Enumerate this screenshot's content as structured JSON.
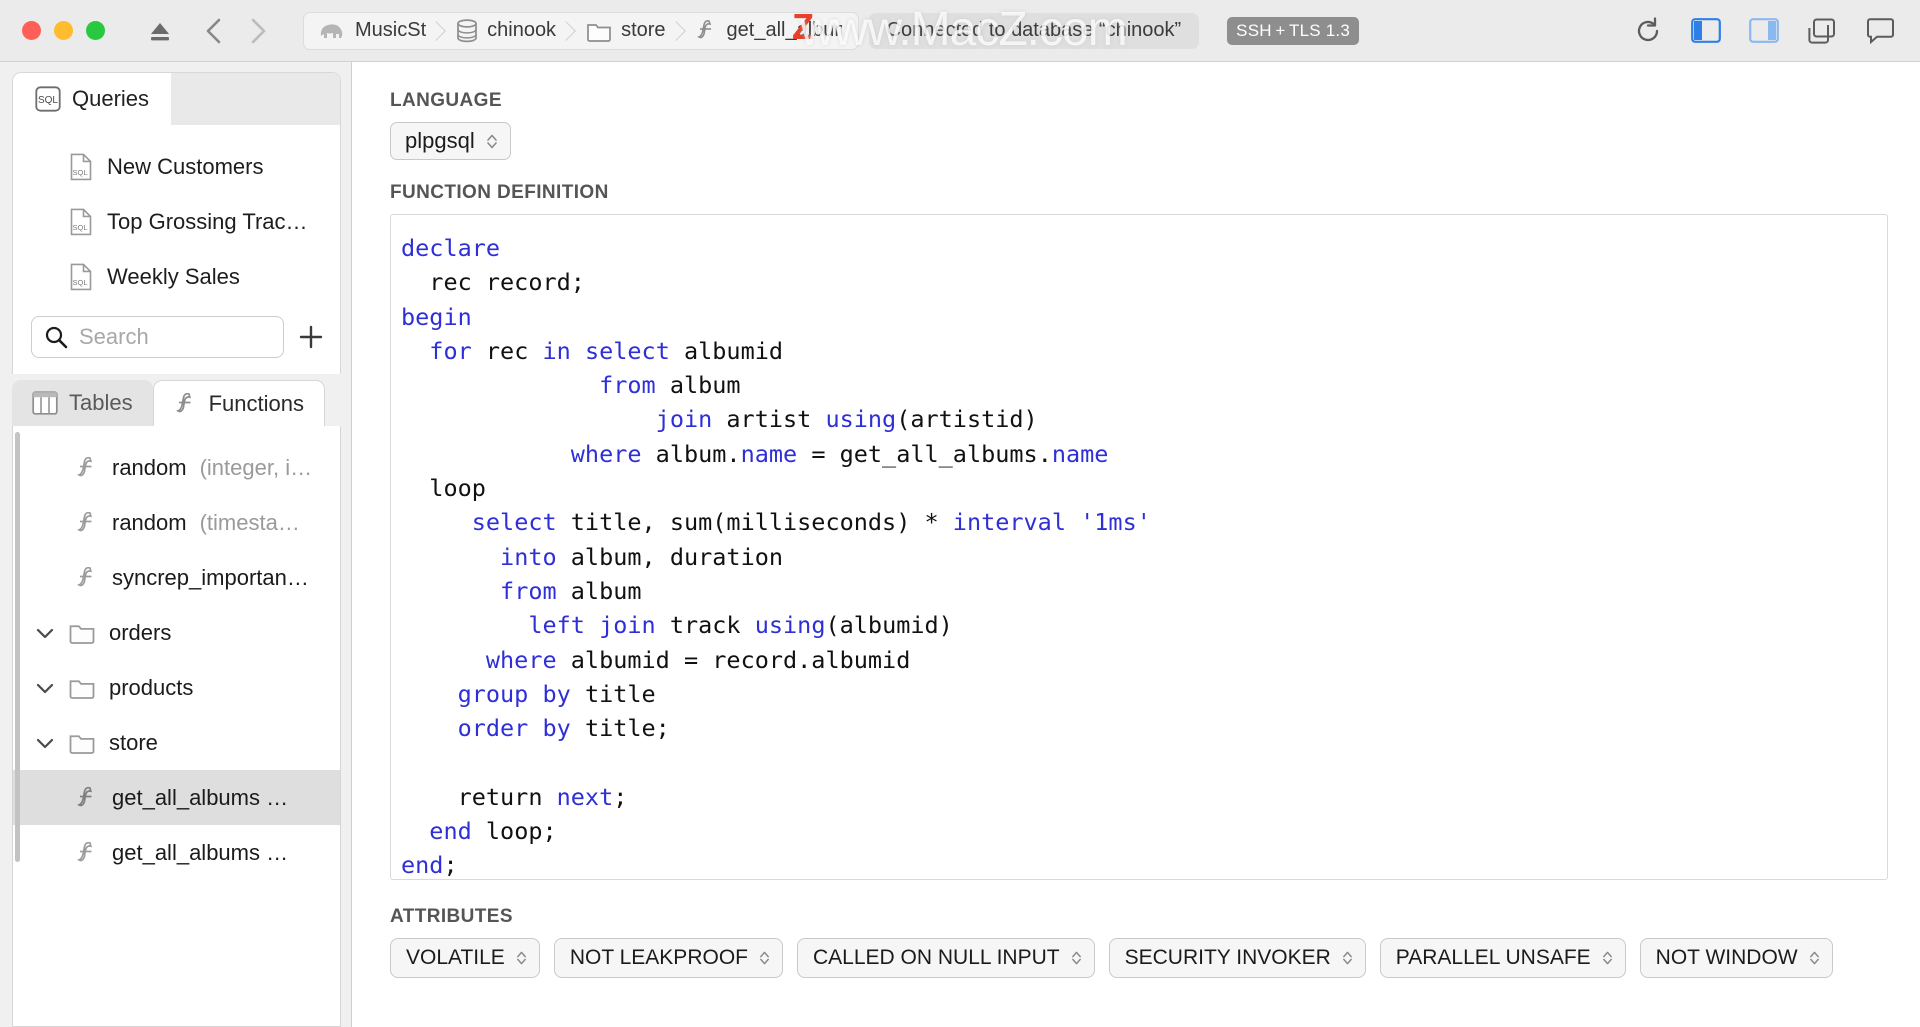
{
  "window": {
    "traffic_lights": [
      "close",
      "minimize",
      "maximize"
    ],
    "watermark": "www.MacZ.com"
  },
  "toolbar": {
    "eject_icon": "eject-icon",
    "back_label": "‹",
    "forward_label": "›",
    "breadcrumb": [
      {
        "label": "MusicSt",
        "icon": "elephant-icon"
      },
      {
        "label": "chinook",
        "icon": "database-icon"
      },
      {
        "label": "store",
        "icon": "folder-icon"
      },
      {
        "label": "get_all_albums",
        "icon": "function-icon"
      }
    ],
    "status": "Connected to database “chinook”",
    "security_badge": "SSH + TLS 1.3",
    "icons": [
      "refresh-icon",
      "left-panel-icon",
      "right-panel-icon",
      "new-window-icon",
      "comment-icon"
    ]
  },
  "sidebar": {
    "queries_tab": {
      "label": "Queries",
      "icon": "sql-icon"
    },
    "queries": [
      {
        "label": "New Customers",
        "icon": "sql-file-icon"
      },
      {
        "label": "Top Grossing Trac…",
        "icon": "sql-file-icon"
      },
      {
        "label": "Weekly Sales",
        "icon": "sql-file-icon"
      }
    ],
    "search": {
      "placeholder": "Search",
      "icon": "search-icon"
    },
    "add_button": "+",
    "lower_tabs": [
      {
        "label": "Tables",
        "icon": "table-icon",
        "active": false
      },
      {
        "label": "Functions",
        "icon": "function-icon",
        "active": true
      }
    ],
    "functions": [
      {
        "name": "random ",
        "args": "(integer, i…",
        "type": "function",
        "indent": 1,
        "selected": false
      },
      {
        "name": "random ",
        "args": "(timesta…",
        "type": "function",
        "indent": 1,
        "selected": false
      },
      {
        "name": "syncrep_importan…",
        "args": "",
        "type": "function",
        "indent": 1,
        "selected": false
      },
      {
        "name": "orders",
        "args": "",
        "type": "folder",
        "indent": 0,
        "selected": false
      },
      {
        "name": "products",
        "args": "",
        "type": "folder",
        "indent": 0,
        "selected": false
      },
      {
        "name": "store",
        "args": "",
        "type": "folder",
        "indent": 0,
        "selected": false
      },
      {
        "name": "get_all_albums …",
        "args": "",
        "type": "function",
        "indent": 1,
        "selected": true
      },
      {
        "name": "get_all_albums …",
        "args": "",
        "type": "function",
        "indent": 1,
        "selected": false
      }
    ]
  },
  "editor": {
    "language_label": "LANGUAGE",
    "language_value": "plpgsql",
    "definition_label": "FUNCTION DEFINITION",
    "code_lines": [
      [
        {
          "t": "declare",
          "k": true
        }
      ],
      [
        {
          "t": "  rec record;",
          "k": false
        }
      ],
      [
        {
          "t": "begin",
          "k": true
        }
      ],
      [
        {
          "t": "  ",
          "k": false
        },
        {
          "t": "for",
          "k": true
        },
        {
          "t": " rec ",
          "k": false
        },
        {
          "t": "in",
          "k": true
        },
        {
          "t": " ",
          "k": false
        },
        {
          "t": "select",
          "k": true
        },
        {
          "t": " albumid",
          "k": false
        }
      ],
      [
        {
          "t": "              ",
          "k": false
        },
        {
          "t": "from",
          "k": true
        },
        {
          "t": " album",
          "k": false
        }
      ],
      [
        {
          "t": "                  ",
          "k": false
        },
        {
          "t": "join",
          "k": true
        },
        {
          "t": " artist ",
          "k": false
        },
        {
          "t": "using",
          "k": true
        },
        {
          "t": "(artistid)",
          "k": false
        }
      ],
      [
        {
          "t": "            ",
          "k": false
        },
        {
          "t": "where",
          "k": true
        },
        {
          "t": " album.",
          "k": false
        },
        {
          "t": "name",
          "k": true
        },
        {
          "t": " = get_all_albums.",
          "k": false
        },
        {
          "t": "name",
          "k": true
        }
      ],
      [
        {
          "t": "  loop",
          "k": false
        }
      ],
      [
        {
          "t": "     ",
          "k": false
        },
        {
          "t": "select",
          "k": true
        },
        {
          "t": " title, sum(milliseconds) * ",
          "k": false
        },
        {
          "t": "interval",
          "k": true
        },
        {
          "t": " ",
          "k": false
        },
        {
          "t": "'1ms'",
          "k": true
        }
      ],
      [
        {
          "t": "       ",
          "k": false
        },
        {
          "t": "into",
          "k": true
        },
        {
          "t": " album, duration",
          "k": false
        }
      ],
      [
        {
          "t": "       ",
          "k": false
        },
        {
          "t": "from",
          "k": true
        },
        {
          "t": " album",
          "k": false
        }
      ],
      [
        {
          "t": "         ",
          "k": false
        },
        {
          "t": "left",
          "k": true
        },
        {
          "t": " ",
          "k": false
        },
        {
          "t": "join",
          "k": true
        },
        {
          "t": " track ",
          "k": false
        },
        {
          "t": "using",
          "k": true
        },
        {
          "t": "(albumid)",
          "k": false
        }
      ],
      [
        {
          "t": "      ",
          "k": false
        },
        {
          "t": "where",
          "k": true
        },
        {
          "t": " albumid = record.albumid",
          "k": false
        }
      ],
      [
        {
          "t": "    ",
          "k": false
        },
        {
          "t": "group",
          "k": true
        },
        {
          "t": " ",
          "k": false
        },
        {
          "t": "by",
          "k": true
        },
        {
          "t": " title",
          "k": false
        }
      ],
      [
        {
          "t": "    ",
          "k": false
        },
        {
          "t": "order",
          "k": true
        },
        {
          "t": " ",
          "k": false
        },
        {
          "t": "by",
          "k": true
        },
        {
          "t": " title;",
          "k": false
        }
      ],
      [
        {
          "t": "",
          "k": false
        }
      ],
      [
        {
          "t": "    return ",
          "k": false
        },
        {
          "t": "next",
          "k": true
        },
        {
          "t": ";",
          "k": false
        }
      ],
      [
        {
          "t": "  ",
          "k": false
        },
        {
          "t": "end",
          "k": true
        },
        {
          "t": " loop;",
          "k": false
        }
      ],
      [
        {
          "t": "end",
          "k": true
        },
        {
          "t": ";",
          "k": false
        }
      ]
    ],
    "keyword_color": "#2f2fd8"
  },
  "attributes": {
    "label": "ATTRIBUTES",
    "items": [
      "VOLATILE",
      "NOT LEAKPROOF",
      "CALLED ON NULL INPUT",
      "SECURITY INVOKER",
      "PARALLEL UNSAFE",
      "NOT WINDOW"
    ]
  }
}
